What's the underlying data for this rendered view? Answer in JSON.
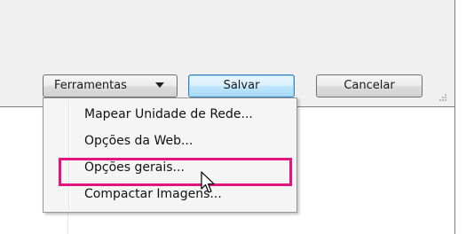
{
  "buttons": {
    "tools_label": "Ferramentas",
    "save_label": "Salvar",
    "cancel_label": "Cancelar"
  },
  "menu": {
    "items": [
      {
        "label": "Mapear Unidade de Rede..."
      },
      {
        "label": "Opções da Web..."
      },
      {
        "label": "Opções gerais..."
      },
      {
        "label": "Compactar Imagens..."
      }
    ]
  },
  "colors": {
    "highlight": "#e2147f",
    "dialog_bg": "#f0f0f0",
    "focus_border": "#3c7fb1"
  },
  "icons": [
    "chevron-down-icon",
    "resize-grip-icon",
    "mouse-pointer-icon"
  ]
}
